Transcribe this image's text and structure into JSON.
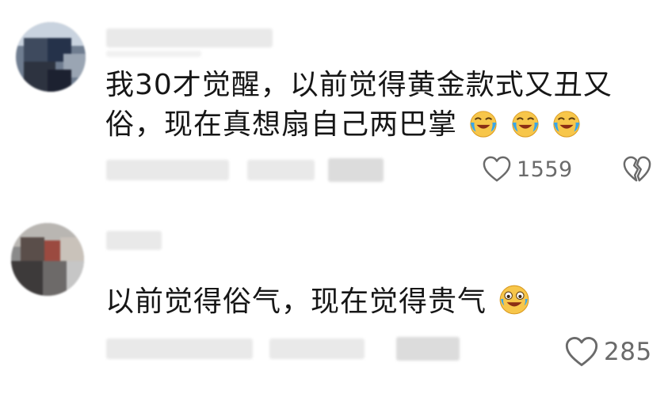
{
  "comments": [
    {
      "text_line1": "我30才觉醒，以前觉得黄金款式又丑又",
      "text_line2": "俗，现在真想扇自己两巴掌",
      "emojis": [
        "crying-laughing-icon",
        "crying-laughing-icon",
        "crying-laughing-icon"
      ],
      "like_count": "1559",
      "like_icon": "heart-icon",
      "dislike_icon": "broken-heart-icon"
    },
    {
      "text_line1": "以前觉得俗气，现在觉得贵气",
      "emojis": [
        "sweat-laughing-icon"
      ],
      "like_count": "285",
      "like_icon": "heart-icon"
    }
  ],
  "colors": {
    "text": "#161616",
    "meta": "#6a6a6a",
    "emoji_yellow": "#f7c64a",
    "emoji_tear": "#3aa6e8"
  }
}
